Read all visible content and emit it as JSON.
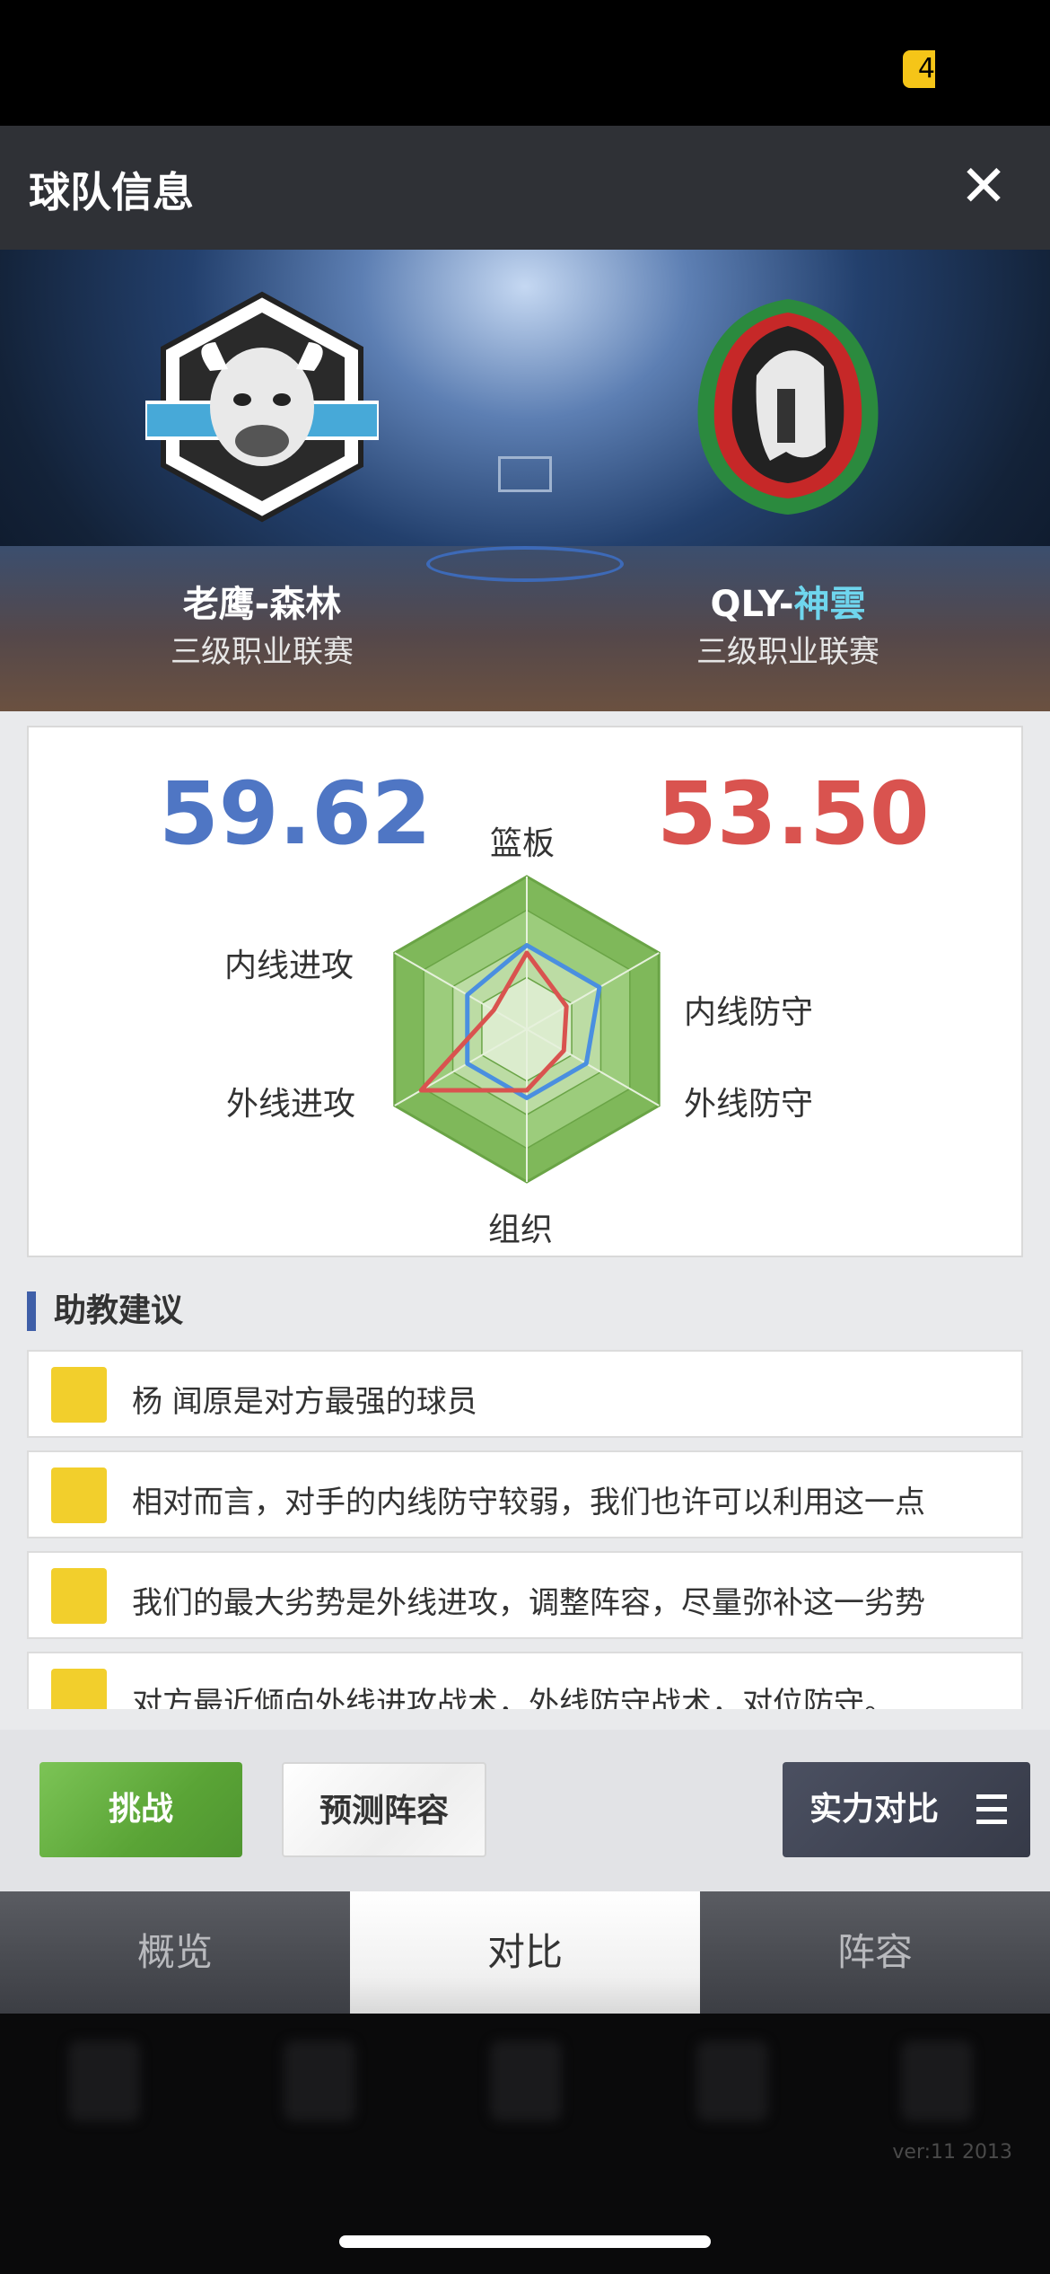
{
  "status": {
    "battery": "4"
  },
  "header": {
    "title": "球队信息"
  },
  "teams": {
    "left": {
      "name": "老鹰-森林",
      "league": "三级职业联赛"
    },
    "right": {
      "name_prefix": "QLY-",
      "name_highlight": "神雲",
      "league": "三级职业联赛"
    }
  },
  "scores": {
    "left": "59.62",
    "right": "53.50"
  },
  "radar": {
    "axes": [
      "篮板",
      "内线防守",
      "外线防守",
      "组织",
      "外线进攻",
      "内线进攻"
    ],
    "colors": {
      "left": "#4a8fe0",
      "right": "#d9534f",
      "hex": "#8dc26a"
    }
  },
  "chart_data": {
    "type": "radar",
    "axes": [
      "篮板",
      "内线防守",
      "外线防守",
      "组织",
      "外线进攻",
      "内线进攻"
    ],
    "series": [
      {
        "values": [
          0.55,
          0.55,
          0.45,
          0.45,
          0.45,
          0.45
        ]
      },
      {
        "values": [
          0.5,
          0.3,
          0.28,
          0.4,
          0.8,
          0.25
        ]
      }
    ],
    "range": [
      0,
      1
    ]
  },
  "coach": {
    "heading": "助教建议",
    "tips": [
      "杨 闻原是对方最强的球员",
      "相对而言，对手的内线防守较弱，我们也许可以利用这一点",
      "我们的最大劣势是外线进攻，调整阵容，尽量弥补这一劣势",
      "对方最近倾向外线进攻战术，外线防守战术，对位防守。"
    ]
  },
  "actions": {
    "challenge": "挑战",
    "predict": "预测阵容",
    "compare": "实力对比"
  },
  "tabs": [
    "概览",
    "对比",
    "阵容"
  ],
  "footer": {
    "version": "ver:11  2013"
  }
}
